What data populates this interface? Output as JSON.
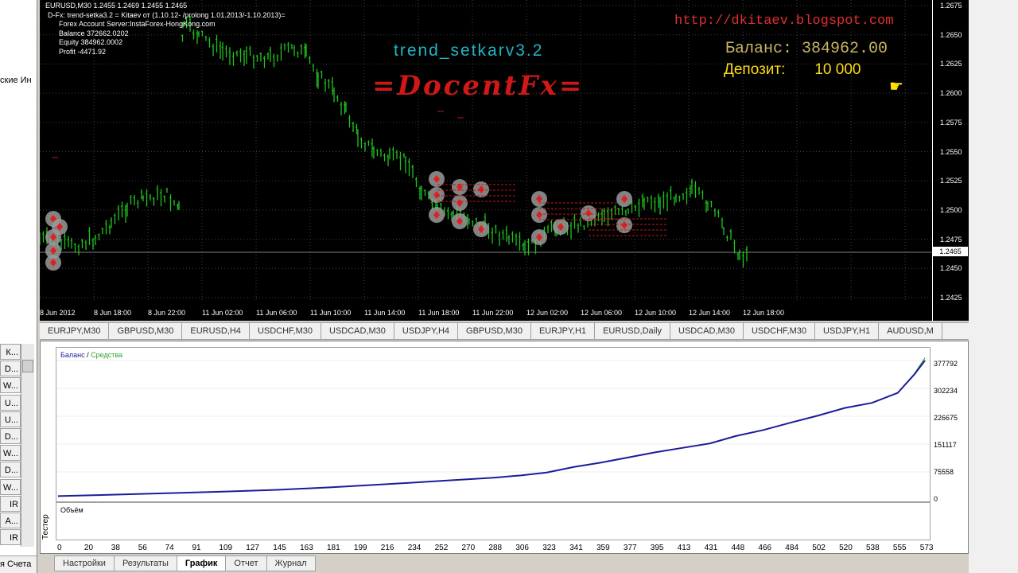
{
  "left_panel": {
    "cut_text": "ские Ин",
    "tabs": [
      "К...",
      "D...",
      "W...",
      "U...",
      "U...",
      "D...",
      "W...",
      "D...",
      "W...",
      "IR",
      "A...",
      "IR"
    ],
    "bottom_label": "я Счета"
  },
  "chart": {
    "info_lines": [
      "EURUSD,M30  1.2455 1.2469 1.2455 1.2465",
      "D-Fx: trend-setka3.2 = Kitaev от (1.10.12- /prolong 1.01.2013/-1.10.2013)=",
      "Forex Account Server:InstaForex-HongKong.com",
      "Balance  372662.0202",
      "Equity  384962.0002",
      "Profit  -4471.92"
    ],
    "strategy_label": "trend_setkarv3.2",
    "brand": "=DocentFx=",
    "blog_url": "http://dkitaev.blogspot.com",
    "balance_label": "Баланс:",
    "balance_value": "384962.00",
    "deposit_label": "Депозит:",
    "deposit_value": "10 000",
    "current_price": "1.2465",
    "price_ticks": [
      "1.2675",
      "1.2650",
      "1.2625",
      "1.2600",
      "1.2575",
      "1.2550",
      "1.2525",
      "1.2500",
      "1.2475",
      "1.2450",
      "1.2425"
    ],
    "time_ticks": [
      "8 Jun 2012",
      "8 Jun 18:00",
      "8 Jun 22:00",
      "11 Jun 02:00",
      "11 Jun 06:00",
      "11 Jun 10:00",
      "11 Jun 14:00",
      "11 Jun 18:00",
      "11 Jun 22:00",
      "12 Jun 02:00",
      "12 Jun 06:00",
      "12 Jun 10:00",
      "12 Jun 14:00",
      "12 Jun 18:00"
    ],
    "colors": {
      "background": "#000000",
      "candle": "#1fc41f",
      "accent_red": "#d01818",
      "balance_text": "#c8b464",
      "deposit_text": "#ffdc14"
    }
  },
  "symbol_tabs": [
    "EURJPY,M30",
    "GBPUSD,M30",
    "EURUSD,H4",
    "USDCHF,M30",
    "USDCAD,M30",
    "USDJPY,H4",
    "GBPUSD,M30",
    "EURJPY,H1",
    "EURUSD,Daily",
    "USDCAD,M30",
    "USDCHF,M30",
    "USDJPY,H1",
    "AUDUSD,M"
  ],
  "tester": {
    "side_label": "Тестер",
    "legend_balance": "Баланс",
    "legend_sep": " / ",
    "legend_equity": "Средства",
    "volume_label": "Объём",
    "bottom_tabs": [
      "Настройки",
      "Результаты",
      "График",
      "Отчет",
      "Журнал"
    ],
    "active_tab": "График",
    "chart_data": {
      "type": "line",
      "title": "",
      "ylim": [
        0,
        377792
      ],
      "y_ticks": [
        "377792",
        "302234",
        "226675",
        "151117",
        "75558",
        "0"
      ],
      "x_ticks": [
        "0",
        "20",
        "38",
        "56",
        "74",
        "91",
        "109",
        "127",
        "145",
        "163",
        "181",
        "199",
        "216",
        "234",
        "252",
        "270",
        "288",
        "306",
        "323",
        "341",
        "359",
        "377",
        "395",
        "413",
        "431",
        "448",
        "466",
        "484",
        "502",
        "520",
        "538",
        "555",
        "573"
      ],
      "x": [
        0,
        38,
        74,
        109,
        145,
        181,
        216,
        252,
        288,
        306,
        323,
        341,
        359,
        377,
        395,
        413,
        431,
        448,
        466,
        484,
        502,
        520,
        538,
        555,
        566,
        573
      ],
      "series": [
        {
          "name": "Баланс",
          "color": "#1c1c9a",
          "values": [
            10000,
            14000,
            18000,
            22000,
            27000,
            34000,
            42000,
            51000,
            60000,
            66000,
            74000,
            89000,
            101000,
            115000,
            129000,
            141000,
            153000,
            173000,
            189000,
            209000,
            228000,
            249000,
            263000,
            290000,
            340000,
            377792
          ]
        },
        {
          "name": "Средства",
          "color": "#2ca02c",
          "values": [
            10000,
            14000,
            18000,
            22000,
            27000,
            34000,
            42000,
            51000,
            60000,
            66000,
            74000,
            89000,
            101000,
            115000,
            129000,
            141000,
            153000,
            173000,
            189000,
            209000,
            228000,
            249000,
            263000,
            290000,
            342000,
            384962
          ]
        }
      ]
    }
  }
}
